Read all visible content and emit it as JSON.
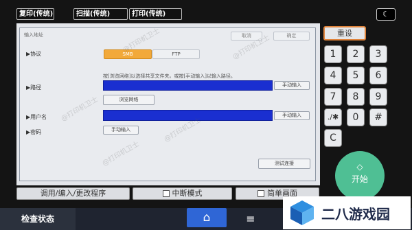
{
  "top_tabs": [
    {
      "label": "复印(传统)"
    },
    {
      "label": "扫描(传统)"
    },
    {
      "label": "打印(传统)"
    }
  ],
  "icons": {
    "moon": "moon-icon",
    "home": "home-icon",
    "menu": "menu-icon",
    "start": "diamond-start-icon"
  },
  "dialog": {
    "title": "输入地址",
    "cancel_label": "取消",
    "ok_label": "确定",
    "protocol_label": "▶协议",
    "protocol_smb": "SMB",
    "protocol_ftp": "FTP",
    "hint": "按[浏览网络]以选择共享文件夹。或按[手动输入]以输入路径。",
    "path_label": "▶路径",
    "path_manual": "手动输入",
    "browse_network": "浏览网络",
    "username_label": "▶用户名",
    "username_manual": "手动输入",
    "password_label": "▶密码",
    "password_manual": "手动输入",
    "test_connection": "测试连接"
  },
  "keypad": {
    "reset": "重设",
    "keys": [
      "1",
      "2",
      "3",
      "4",
      "5",
      "6",
      "7",
      "8",
      "9",
      ".∕✱",
      "0",
      "#",
      "C"
    ]
  },
  "start_label": "开始",
  "bottom_bar": {
    "program": "调用/编入/更改程序",
    "interrupt": "中断模式",
    "simple": "简单画面"
  },
  "status_bar": {
    "check_status": "检查状态"
  },
  "watermark": {
    "text": "@打印机卫士",
    "logo_text": "二八游戏园"
  },
  "colors": {
    "smb_selected": "#f2a93a",
    "input_fill": "#1a2fd0",
    "start_green": "#4fbf94",
    "reset_border": "#e0843c"
  }
}
